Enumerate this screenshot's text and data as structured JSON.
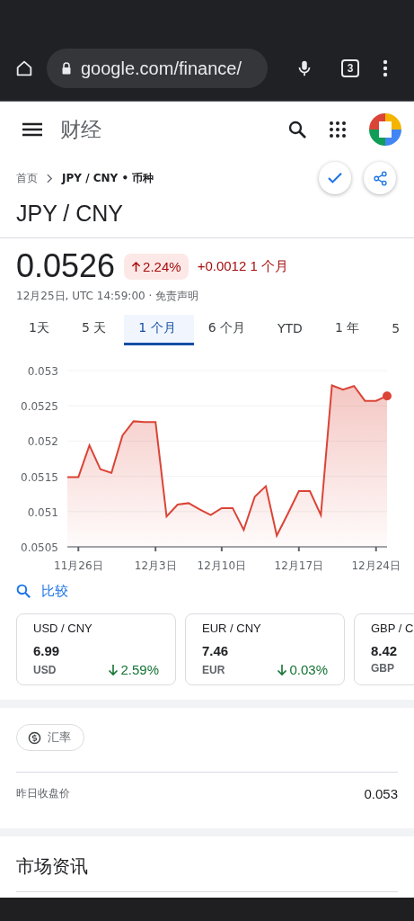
{
  "browser": {
    "url": "google.com/finance/",
    "tab_count": "3"
  },
  "header": {
    "title": "财经"
  },
  "breadcrumb": {
    "home": "首页",
    "current": "JPY / CNY • 币种",
    "followed": true
  },
  "title": "JPY / CNY",
  "quote": {
    "price": "0.0526",
    "rising": true,
    "change_pct": "2.24%",
    "change": "+0.0012 1 个月",
    "timestamp": "12月25日, UTC 14:59:00 · 免责声明"
  },
  "ranges": [
    {
      "label": "1天",
      "selected": false
    },
    {
      "label": "5 天",
      "selected": false
    },
    {
      "label": "1 个月",
      "selected": true
    },
    {
      "label": "6 个月",
      "selected": false
    },
    {
      "label": "YTD",
      "selected": false
    },
    {
      "label": "1 年",
      "selected": false
    },
    {
      "label": "5",
      "selected": false
    }
  ],
  "chart_data": {
    "type": "area",
    "categories": [
      null,
      "11月26日",
      null,
      null,
      null,
      null,
      null,
      null,
      "12月3日",
      null,
      null,
      null,
      null,
      null,
      "12月10日",
      null,
      null,
      null,
      null,
      null,
      null,
      "12月17日",
      null,
      null,
      null,
      null,
      null,
      null,
      "12月24日",
      null
    ],
    "series": [
      {
        "color": "#db4437",
        "values": [
          0.05149,
          0.05149,
          0.05194,
          0.0516,
          0.05155,
          0.05208,
          0.05228,
          0.05227,
          0.05227,
          0.05093,
          0.0511,
          0.05112,
          0.05103,
          0.05095,
          0.05105,
          0.05105,
          0.05074,
          0.05121,
          0.05136,
          0.05066,
          0.05097,
          0.05129,
          0.05129,
          0.05095,
          0.05279,
          0.05273,
          0.05278,
          0.05257,
          0.05257,
          0.05264
        ]
      }
    ],
    "ylim": [
      0.0505,
      0.053
    ],
    "grid": true,
    "yticks": [
      {
        "value": 0.0505,
        "label": "0.0505"
      },
      {
        "value": 0.051,
        "label": "0.051"
      },
      {
        "value": 0.0515,
        "label": "0.0515"
      },
      {
        "value": 0.052,
        "label": "0.052"
      },
      {
        "value": 0.0525,
        "label": "0.0525"
      },
      {
        "value": 0.053,
        "label": "0.053"
      }
    ]
  },
  "compare": {
    "label": "比较"
  },
  "cards": [
    {
      "pair": "USD / CNY",
      "price": "6.99",
      "currency": "USD",
      "rising": false,
      "change": "2.59%"
    },
    {
      "pair": "EUR / CNY",
      "price": "7.46",
      "currency": "EUR",
      "rising": false,
      "change": "0.03%"
    },
    {
      "pair": "GBP / C",
      "price": "8.42",
      "currency": "GBP"
    }
  ],
  "chip": {
    "label": "汇率"
  },
  "stats": [
    {
      "label": "昨日收盘价",
      "value": "0.053"
    }
  ],
  "news": {
    "title": "市场资讯"
  }
}
